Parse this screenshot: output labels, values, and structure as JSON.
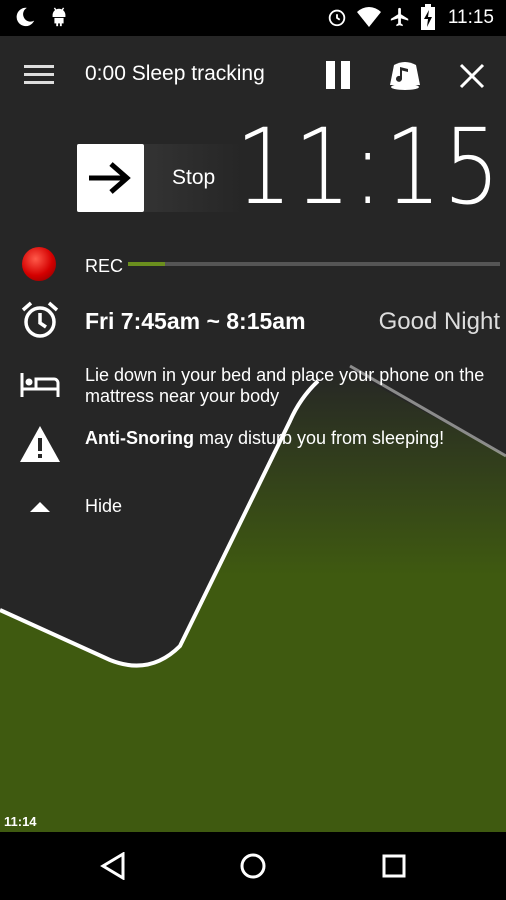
{
  "status_bar": {
    "time": "11:15",
    "icons": [
      "moon-icon",
      "android-icon",
      "alarm-icon",
      "wifi-icon",
      "airplane-icon",
      "battery-charging-icon"
    ]
  },
  "top_bar": {
    "title": "0:00 Sleep tracking",
    "icons": [
      "menu-icon",
      "pause-icon",
      "lullaby-icon",
      "close-icon"
    ]
  },
  "clock": {
    "time": "11:15"
  },
  "stop_slider": {
    "label": "Stop",
    "icon": "arrow-right-icon"
  },
  "rec": {
    "label": "REC",
    "progress": 0.1
  },
  "alarm": {
    "time_range": "Fri 7:45am ~ 8:15am",
    "greeting": "Good Night"
  },
  "instruction": {
    "text": "Lie down in your bed and place your phone on the mattress near your body"
  },
  "warning": {
    "bold": "Anti-Snoring",
    "rest": " may disturb you from sleeping!"
  },
  "hide": {
    "label": "Hide"
  },
  "graph": {
    "start_time": "11:14",
    "fill_color": "#3f5a10"
  },
  "nav_bar": {
    "icons": [
      "back-icon",
      "home-icon",
      "recents-icon"
    ]
  }
}
